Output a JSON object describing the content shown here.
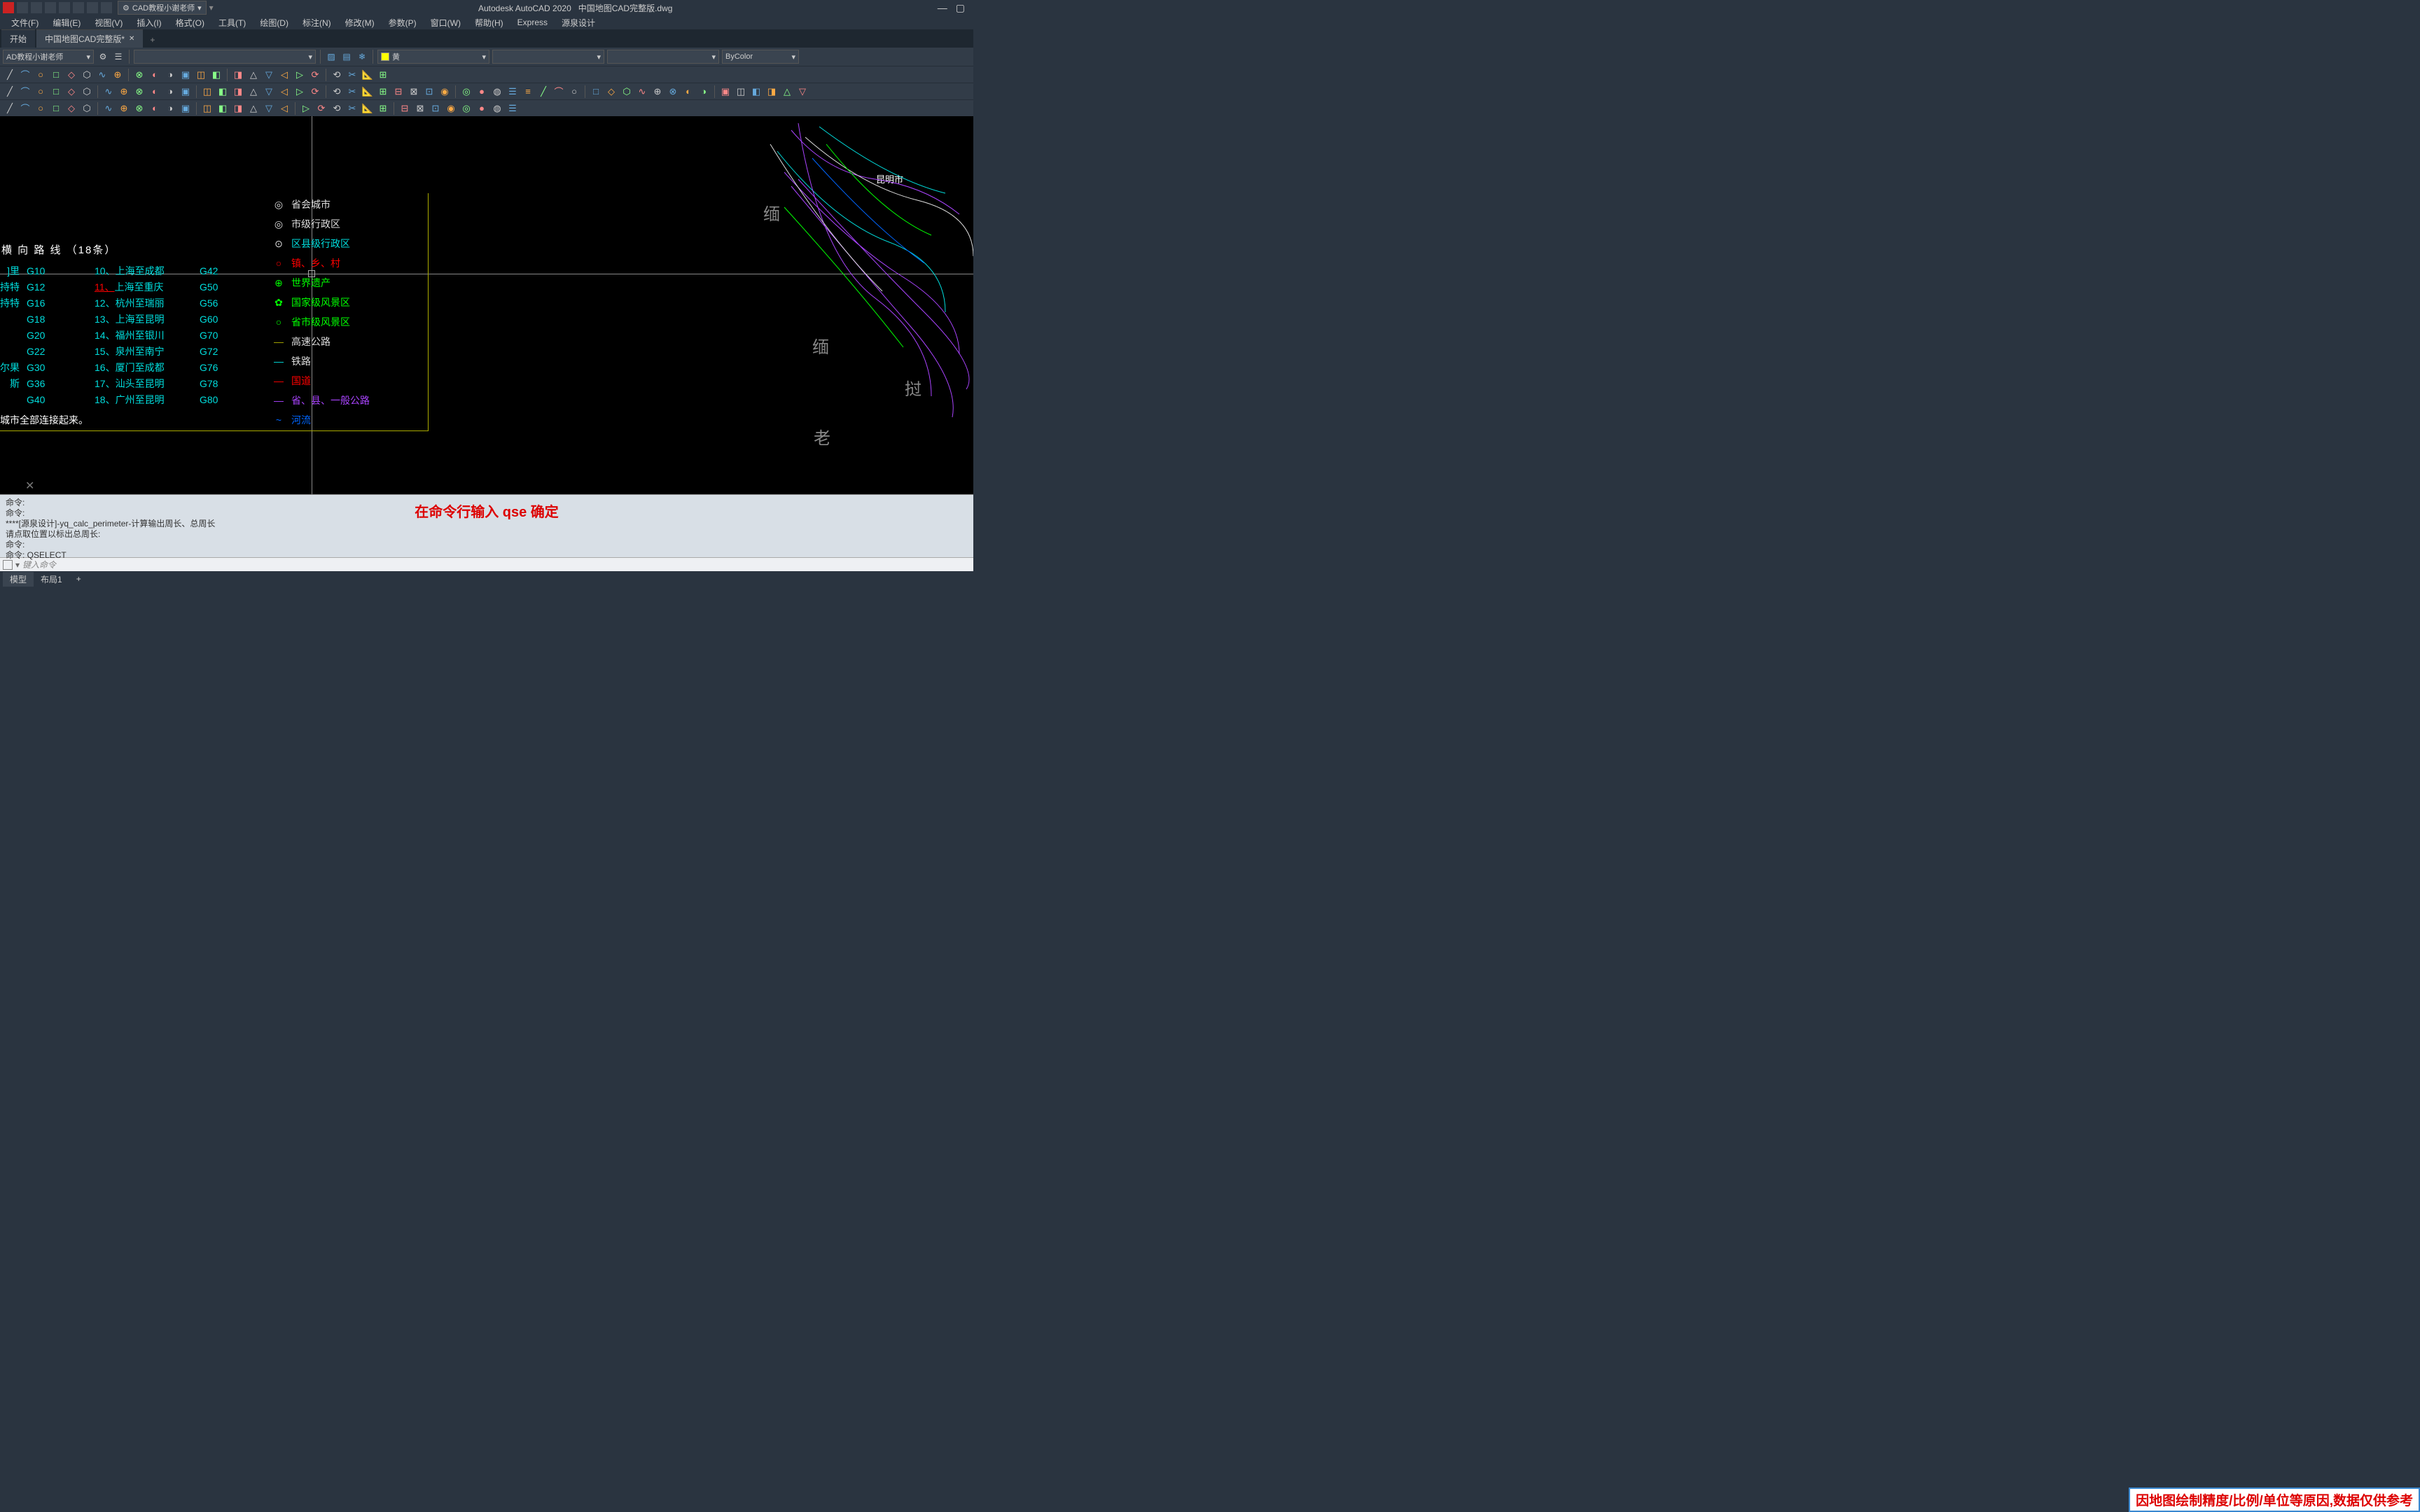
{
  "app": {
    "title_left": "Autodesk AutoCAD 2020",
    "title_file": "中国地图CAD完整版.dwg",
    "workspace": "CAD教程小谢老师"
  },
  "menu": [
    "文件(F)",
    "编辑(E)",
    "视图(V)",
    "插入(I)",
    "格式(O)",
    "工具(T)",
    "绘图(D)",
    "标注(N)",
    "修改(M)",
    "参数(P)",
    "窗口(W)",
    "帮助(H)",
    "Express",
    "源泉设计"
  ],
  "tabs": {
    "start": "开始",
    "file": "中国地图CAD完整版*",
    "add": "+"
  },
  "props": {
    "layer_combo": "AD教程小谢老师",
    "color_name": "黄",
    "lineweight": "ByColor"
  },
  "routes": {
    "header": "横 向 路 线 （18条）",
    "col0": [
      "]里",
      "持特",
      "持特",
      "",
      "",
      "",
      "尔果斯",
      "",
      ""
    ],
    "col1": [
      "G10",
      "G12",
      "G16",
      "G18",
      "G20",
      "G22",
      "G30",
      "G36",
      "G40"
    ],
    "col2": [
      "10、上海至成都",
      "11、上海至重庆",
      "12、杭州至瑞丽",
      "13、上海至昆明",
      "14、福州至银川",
      "15、泉州至南宁",
      "16、厦门至成都",
      "17、汕头至昆明",
      "18、广州至昆明"
    ],
    "col3": [
      "G42",
      "G50",
      "G56",
      "G60",
      "G70",
      "G72",
      "G76",
      "G78",
      "G80"
    ],
    "note": "城市全部连接起来。",
    "underlined_idx": 1
  },
  "legend": [
    {
      "sym": "◎",
      "color": "#ddd",
      "label": "省会城市",
      "lcolor": "#ddd"
    },
    {
      "sym": "◎",
      "color": "#ddd",
      "label": "市级行政区",
      "lcolor": "#ddd"
    },
    {
      "sym": "⊙",
      "color": "#ddd",
      "label": "区县级行政区",
      "lcolor": "#0dd"
    },
    {
      "sym": "○",
      "color": "#f00",
      "label": "镇、乡、村",
      "lcolor": "#f00"
    },
    {
      "sym": "⊕",
      "color": "#0f0",
      "label": "世界遗产",
      "lcolor": "#0f0"
    },
    {
      "sym": "✿",
      "color": "#0f0",
      "label": "国家级风景区",
      "lcolor": "#0f0"
    },
    {
      "sym": "○",
      "color": "#0f0",
      "label": "省市级风景区",
      "lcolor": "#0f0"
    },
    {
      "sym": "—",
      "color": "#aa0",
      "label": "高速公路",
      "lcolor": "#ddd"
    },
    {
      "sym": "—",
      "color": "#0dd",
      "label": "铁路",
      "lcolor": "#ddd"
    },
    {
      "sym": "—",
      "color": "#f00",
      "label": "国道",
      "lcolor": "#f00"
    },
    {
      "sym": "—",
      "color": "#a4f",
      "label": "省、县、一般公路",
      "lcolor": "#a4f"
    },
    {
      "sym": "~",
      "color": "#06f",
      "label": "河流",
      "lcolor": "#06f"
    }
  ],
  "map": {
    "city": "昆明市",
    "countries": [
      "缅",
      "缅",
      "挝",
      "老"
    ]
  },
  "cmd": {
    "lines": [
      "命令:",
      "命令:",
      "****[源泉设计]-yq_calc_perimeter-计算输出周长、总周长",
      "请点取位置以标出总周长:",
      "命令:",
      "命令: QSELECT"
    ],
    "overlay": "在命令行输入 qse 确定",
    "placeholder": "键入命令"
  },
  "status": {
    "model": "模型",
    "layout": "布局1",
    "add": "+"
  },
  "disclaimer": "因地图绘制精度/比例/单位等原因,数据仅供参考"
}
